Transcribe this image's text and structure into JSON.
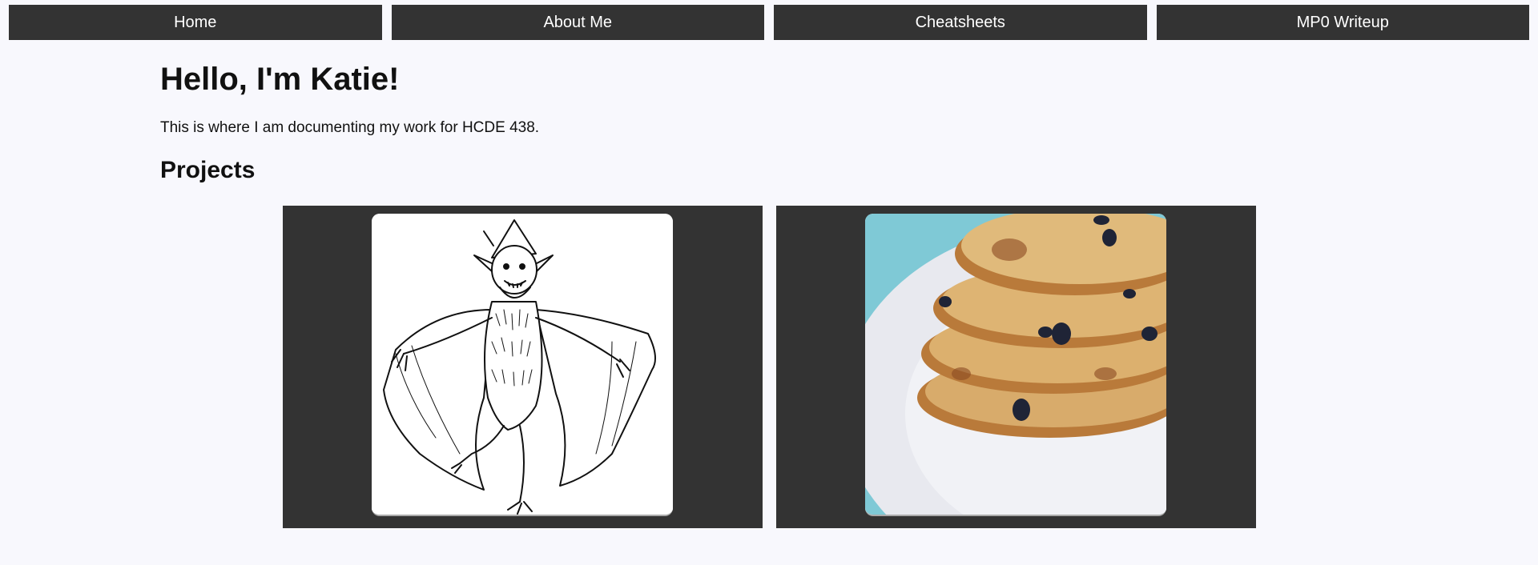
{
  "nav": {
    "items": [
      {
        "label": "Home"
      },
      {
        "label": "About Me"
      },
      {
        "label": "Cheatsheets"
      },
      {
        "label": "MP0 Writeup"
      }
    ]
  },
  "main": {
    "title": "Hello, I'm Katie!",
    "intro": "This is where I am documenting my work for HCDE 438.",
    "projects_heading": "Projects"
  },
  "projects": [
    {
      "image": "goblin-illustration"
    },
    {
      "image": "cookie-stack-photo"
    }
  ],
  "colors": {
    "nav_bg": "#333333",
    "nav_text": "#ffffff",
    "page_bg": "#f8f8fd",
    "card_bg": "#333333"
  }
}
